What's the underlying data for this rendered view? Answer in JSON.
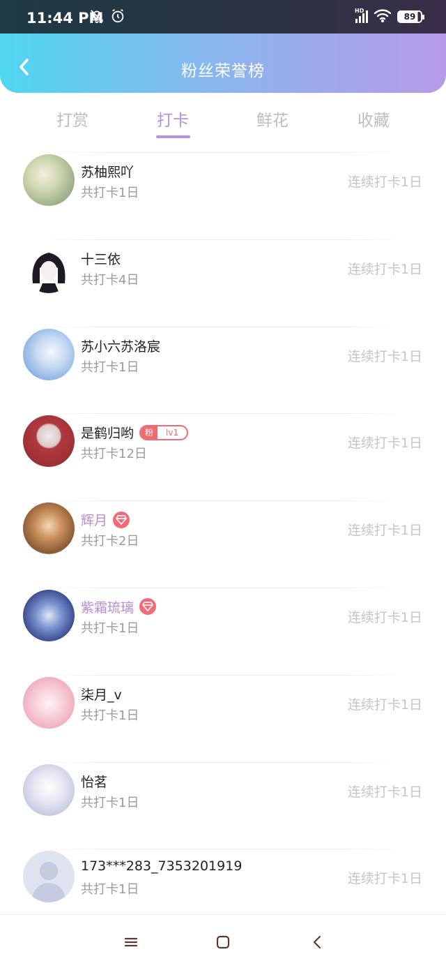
{
  "status_bar": {
    "time": "11:44 PM",
    "network": "HD",
    "battery": "89"
  },
  "header": {
    "title": "粉丝荣誉榜",
    "back_icon": "chevron-left-icon"
  },
  "tabs": [
    {
      "label": "打赏",
      "active": false
    },
    {
      "label": "打卡",
      "active": true
    },
    {
      "label": "鲜花",
      "active": false
    },
    {
      "label": "收藏",
      "active": false
    }
  ],
  "colors": {
    "accent": "#b593e0",
    "vip_name": "#b88ad8",
    "badge_red": "#f06a72"
  },
  "fans": [
    {
      "name": "苏柚熙吖",
      "days": "共打卡1日",
      "streak": "连续打卡1日",
      "badge": null
    },
    {
      "name": "十三依",
      "days": "共打卡4日",
      "streak": "连续打卡1日",
      "badge": null
    },
    {
      "name": "苏小六苏洛宸",
      "days": "共打卡1日",
      "streak": "连续打卡1日",
      "badge": null
    },
    {
      "name": "是鹤归哟",
      "days": "共打卡12日",
      "streak": "连续打卡1日",
      "badge": "fan",
      "fan_badge": {
        "left": "粉",
        "right": "lv1"
      }
    },
    {
      "name": "辉月",
      "days": "共打卡2日",
      "streak": "连续打卡1日",
      "badge": "vip"
    },
    {
      "name": "紫霜琉璃",
      "days": "共打卡1日",
      "streak": "连续打卡1日",
      "badge": "vip"
    },
    {
      "name": "柒月_v",
      "days": "共打卡1日",
      "streak": "连续打卡1日",
      "badge": null
    },
    {
      "name": "怡茗",
      "days": "共打卡1日",
      "streak": "连续打卡1日",
      "badge": null
    },
    {
      "name": "173***283_7353201919",
      "days": "共打卡1日",
      "streak": "连续打卡1日",
      "badge": null
    }
  ],
  "nav": {
    "menu_icon": "menu-icon",
    "home_icon": "home-square-icon",
    "back_icon": "back-triangle-icon"
  }
}
